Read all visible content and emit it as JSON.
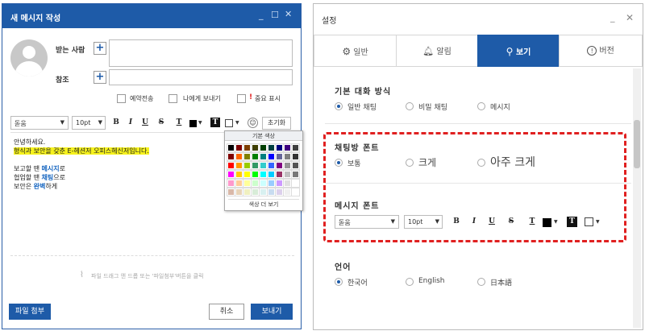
{
  "left": {
    "title": "새 메시지 작성",
    "recipient_label": "받는 사람",
    "cc_label": "참조",
    "options": [
      "예약전송",
      "나에게 보내기",
      "중요 표시"
    ],
    "important_mark": "!",
    "toolbar": {
      "font": "돋움",
      "size": "10pt",
      "bold": "B",
      "italic": "I",
      "underline": "U",
      "strike": "S",
      "textcolor": "T",
      "bgcolor": "T",
      "reset": "초기화"
    },
    "body_lines": [
      "안녕하세요.",
      "형식과 보안을 갖춘 E-헤션저 오피스헤신저입니다.",
      "",
      "보고할 땐 메시지로",
      "협업할 땐 채팅으로",
      "보안은 완벽하게"
    ],
    "body_highlights": {
      "line4": "메시지",
      "line5": "채팅",
      "line6": "완벽"
    },
    "palette": {
      "title": "기본 색상",
      "more": "색상 더 보기",
      "colors": [
        [
          "#000000",
          "#7f0000",
          "#7f3f00",
          "#3f3f00",
          "#003f00",
          "#003f3f",
          "#00007f",
          "#3f007f",
          "#3f3f3f"
        ],
        [
          "#800000",
          "#ff6600",
          "#808000",
          "#008000",
          "#008080",
          "#0000ff",
          "#666699",
          "#808080",
          "#333333"
        ],
        [
          "#ff0000",
          "#ff9900",
          "#99cc00",
          "#339966",
          "#33cccc",
          "#3366ff",
          "#800080",
          "#969696",
          "#555555"
        ],
        [
          "#ff00ff",
          "#ffcc00",
          "#ffff00",
          "#00ff00",
          "#00ffff",
          "#00ccff",
          "#993366",
          "#c0c0c0",
          "#777777"
        ],
        [
          "#ff99cc",
          "#ffcc99",
          "#ffff99",
          "#ccffcc",
          "#ccffff",
          "#99ccff",
          "#cc99ff",
          "#e0e0e0",
          "#ffffff"
        ],
        [
          "#d9b8a8",
          "#e8d4b8",
          "#f0f0c0",
          "#d8ecd8",
          "#d8f0f0",
          "#c8dcf0",
          "#dcd0ec",
          "#f0f0f0",
          "#ffffff"
        ]
      ]
    },
    "attach_hint": "파일 드래그 앤 드롭 또는 '파일첨부'버튼을 클릭",
    "attach_button": "파일 첨부",
    "cancel_button": "취소",
    "send_button": "보내기"
  },
  "right": {
    "title": "설정",
    "tabs": [
      {
        "label": "일반",
        "icon": "gear-icon"
      },
      {
        "label": "알림",
        "icon": "bell-icon"
      },
      {
        "label": "보기",
        "icon": "search-icon"
      },
      {
        "label": "버전",
        "icon": "info-icon"
      }
    ],
    "chat_mode": {
      "title": "기본 대화 방식",
      "options": [
        "일반 채팅",
        "비밀 채팅",
        "메시지"
      ],
      "selected": 0
    },
    "chat_font": {
      "title": "채팅방 폰트",
      "options": [
        "보통",
        "크게",
        "아주 크게"
      ],
      "selected": 0
    },
    "message_font": {
      "title": "메시지 폰트",
      "font": "돋움",
      "size": "10pt",
      "bold": "B",
      "italic": "I",
      "underline": "U",
      "strike": "S",
      "textcolor": "T",
      "bgcolor": "T"
    },
    "language": {
      "title": "언어",
      "options": [
        "한국어",
        "English",
        "日本語"
      ],
      "selected": 0
    },
    "accent": "#1e5ba8",
    "highlight_color": "#e02020"
  }
}
